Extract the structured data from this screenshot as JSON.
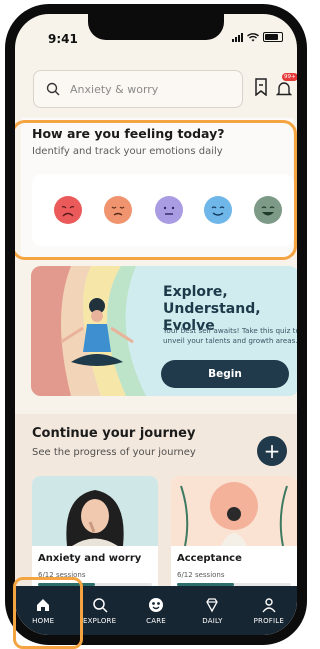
{
  "status": {
    "time": "9:41"
  },
  "search": {
    "placeholder": "Anxiety & worry",
    "notification_badge": "99+"
  },
  "feelings": {
    "title": "How are you feeling today?",
    "subtitle": "Identify and track your emotions daily",
    "moods": [
      {
        "icon": "very-sad-face-icon",
        "color": "#ea5a5a"
      },
      {
        "icon": "sad-face-icon",
        "color": "#f0946f"
      },
      {
        "icon": "neutral-face-icon",
        "color": "#a99ce3"
      },
      {
        "icon": "happy-face-icon",
        "color": "#6fb6e9"
      },
      {
        "icon": "very-happy-face-icon",
        "color": "#7d9a86"
      }
    ]
  },
  "explore": {
    "title_line1": "Explore,",
    "title_line2": "Understand, Evolve",
    "description": "Your best self awaits! Take this quiz to unveil your talents and growth areas.",
    "button_label": "Begin"
  },
  "journey": {
    "title": "Continue your journey",
    "subtitle": "See the progress of your journey",
    "cards": [
      {
        "title": "Anxiety and worry",
        "sessions": "6/12 sessions",
        "progress": 0.5
      },
      {
        "title": "Acceptance",
        "sessions": "6/12 sessions",
        "progress": 0.5
      }
    ]
  },
  "nav": {
    "items": [
      {
        "label": "HOME",
        "icon": "home-icon"
      },
      {
        "label": "EXPLORE",
        "icon": "search-icon"
      },
      {
        "label": "CARE",
        "icon": "care-icon"
      },
      {
        "label": "DAILY",
        "icon": "diamond-icon"
      },
      {
        "label": "PROFILE",
        "icon": "profile-icon"
      }
    ]
  },
  "colors": {
    "accent": "#20394b",
    "highlight": "#f5a442",
    "nav_bg": "#172633"
  }
}
